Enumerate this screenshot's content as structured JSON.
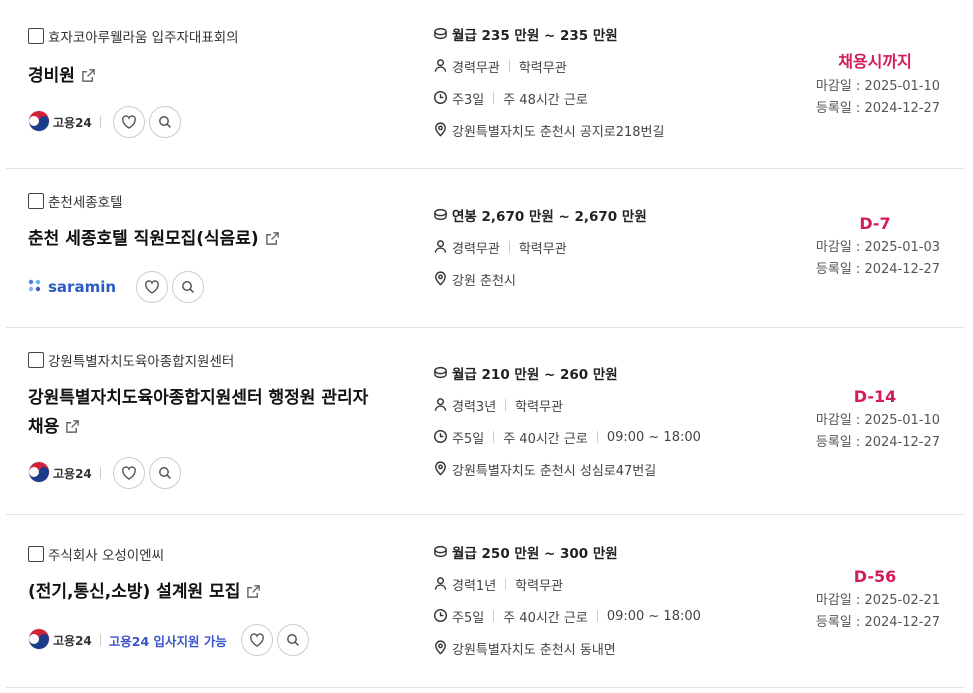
{
  "colors": {
    "accent": "#d21d5a",
    "link": "#3a55c9"
  },
  "jobs": [
    {
      "company": "효자코아루웰라움 입주자대표회의",
      "title_line1": "경비원",
      "title_line2": "",
      "source": "고용24",
      "apply_support": "",
      "salary": "월급 235 만원 ~ 235 만원",
      "experience": "경력무관",
      "education": "학력무관",
      "days": "주3일",
      "hours": "주 48시간 근로",
      "time": "",
      "location": "강원특별자치도 춘천시 공지로218번길",
      "dday": "채용시까지",
      "deadline": "마감일 : 2025-01-10",
      "registered": "등록일 : 2024-12-27"
    },
    {
      "company": "춘천세종호텔",
      "title_line1": "춘천 세종호텔 직원모집(식음료)",
      "title_line2": "",
      "source": "saramin",
      "apply_support": "",
      "salary": "연봉 2,670 만원 ~ 2,670 만원",
      "experience": "경력무관",
      "education": "학력무관",
      "days": "",
      "hours": "",
      "time": "",
      "location": "강원 춘천시",
      "dday": "D-7",
      "deadline": "마감일 : 2025-01-03",
      "registered": "등록일 : 2024-12-27"
    },
    {
      "company": "강원특별자치도육아종합지원센터",
      "title_line1": "강원특별자치도육아종합지원센터 행정원 관리자",
      "title_line2": "채용",
      "source": "고용24",
      "apply_support": "",
      "salary": "월급 210 만원 ~ 260 만원",
      "experience": "경력3년",
      "education": "학력무관",
      "days": "주5일",
      "hours": "주 40시간 근로",
      "time": "09:00 ~ 18:00",
      "location": "강원특별자치도 춘천시 성심로47번길",
      "dday": "D-14",
      "deadline": "마감일 : 2025-01-10",
      "registered": "등록일 : 2024-12-27"
    },
    {
      "company": "주식회사 오성이엔씨",
      "title_line1": "(전기,통신,소방) 설계원 모집",
      "title_line2": "",
      "source": "고용24",
      "apply_support": "고용24 입사지원 가능",
      "salary": "월급 250 만원 ~ 300 만원",
      "experience": "경력1년",
      "education": "학력무관",
      "days": "주5일",
      "hours": "주 40시간 근로",
      "time": "09:00 ~ 18:00",
      "location": "강원특별자치도 춘천시 동내면",
      "dday": "D-56",
      "deadline": "마감일 : 2025-02-21",
      "registered": "등록일 : 2024-12-27"
    }
  ]
}
